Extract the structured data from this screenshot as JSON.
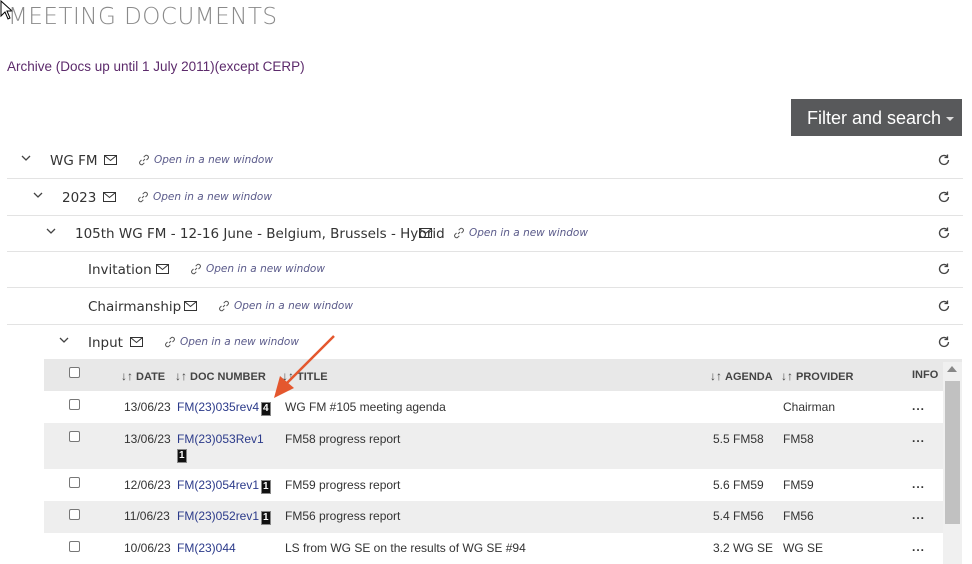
{
  "page_title": "MEETING DOCUMENTS",
  "archive_link": "Archive (Docs up until 1 July 2011)(except CERP)",
  "filter_button": "Filter and search",
  "open_new_window": "Open in a new window",
  "tree": [
    {
      "label": "WG FM",
      "expandable": true
    },
    {
      "label": "2023",
      "expandable": true
    },
    {
      "label": "105th WG FM - 12-16 June - Belgium, Brussels - Hybrid",
      "expandable": true
    },
    {
      "label": "Invitation",
      "expandable": false
    },
    {
      "label": "Chairmanship",
      "expandable": false
    },
    {
      "label": "Input",
      "expandable": true
    }
  ],
  "table": {
    "headers": {
      "date": "DATE",
      "doc_number": "DOC NUMBER",
      "title": "TITLE",
      "agenda": "AGENDA",
      "provider": "PROVIDER",
      "info": "INFO"
    },
    "sort_glyph": "↓↑",
    "info_glyph": "...",
    "rows": [
      {
        "date": "13/06/23",
        "doc_number": "FM(23)035rev4",
        "badge": "4",
        "title": "WG FM #105 meeting agenda",
        "agenda": "",
        "provider": "Chairman"
      },
      {
        "date": "13/06/23",
        "doc_number": "FM(23)053Rev1",
        "badge": "1",
        "title": "FM58 progress report",
        "agenda": "5.5 FM58",
        "provider": "FM58"
      },
      {
        "date": "12/06/23",
        "doc_number": "FM(23)054rev1",
        "badge": "1",
        "title": "FM59 progress report",
        "agenda": "5.6 FM59",
        "provider": "FM59"
      },
      {
        "date": "11/06/23",
        "doc_number": "FM(23)052rev1",
        "badge": "1",
        "title": "FM56 progress report",
        "agenda": "5.4 FM56",
        "provider": "FM56"
      },
      {
        "date": "10/06/23",
        "doc_number": "FM(23)044",
        "badge": "",
        "title": "LS from WG SE on the results of WG SE #94",
        "agenda": "3.2 WG SE",
        "provider": "WG SE"
      }
    ]
  },
  "colors": {
    "accent_button": "#58595b",
    "link_purple": "#5c2a6b",
    "doc_link": "#2b3a8a",
    "annotation_arrow": "#e4572e"
  },
  "icons": [
    "chevron-down-icon",
    "envelope-icon",
    "link-icon",
    "refresh-icon",
    "sort-icon",
    "mouse-cursor-icon",
    "annotation-arrow-icon"
  ]
}
